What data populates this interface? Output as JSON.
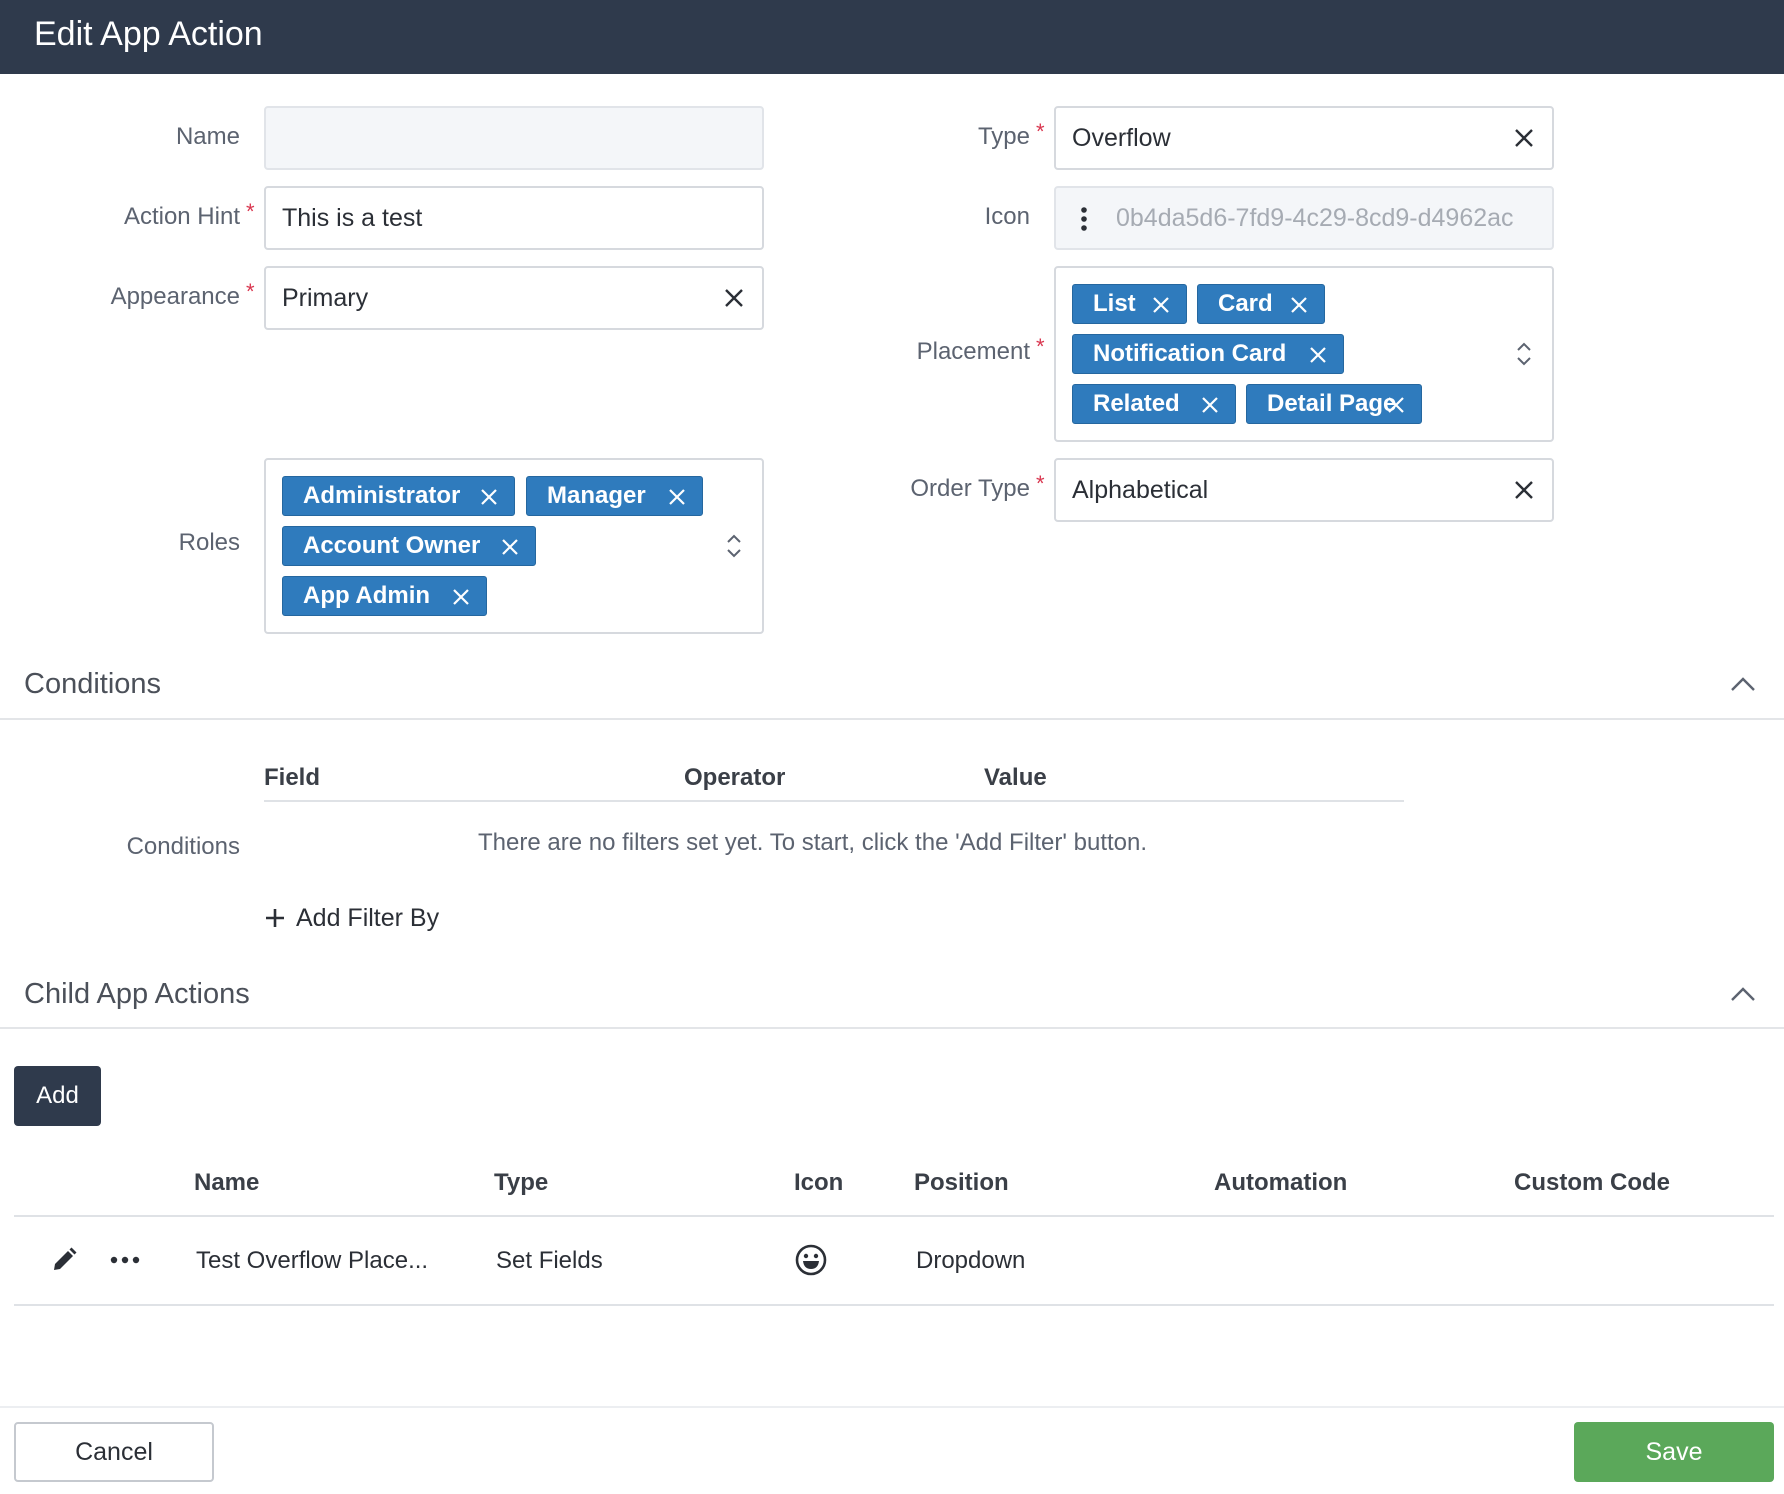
{
  "header": {
    "title": "Edit App Action"
  },
  "form": {
    "name": {
      "label": "Name",
      "value": ""
    },
    "action_hint": {
      "label": "Action Hint",
      "value": "This is a test"
    },
    "appearance": {
      "label": "Appearance",
      "value": "Primary"
    },
    "roles": {
      "label": "Roles",
      "chips": [
        "Administrator",
        "Manager",
        "Account Owner",
        "App Admin"
      ]
    },
    "type": {
      "label": "Type",
      "value": "Overflow"
    },
    "icon": {
      "label": "Icon",
      "value": "0b4da5d6-7fd9-4c29-8cd9-d4962ac"
    },
    "placement": {
      "label": "Placement",
      "chips": [
        "List",
        "Card",
        "Notification Card",
        "Related",
        "Detail Page"
      ]
    },
    "order_type": {
      "label": "Order Type",
      "value": "Alphabetical"
    },
    "required_mark": "*"
  },
  "conditions_section": {
    "title": "Conditions",
    "row_label": "Conditions",
    "columns": [
      "Field",
      "Operator",
      "Value"
    ],
    "empty_message": "There are no filters set yet. To start, click the 'Add Filter' button.",
    "add_filter_label": "Add Filter By"
  },
  "child_actions_section": {
    "title": "Child App Actions",
    "add_label": "Add",
    "columns": [
      "Name",
      "Type",
      "Icon",
      "Position",
      "Automation",
      "Custom Code"
    ],
    "rows": [
      {
        "name": "Test Overflow Place...",
        "type": "Set Fields",
        "icon": "grinning-face-icon",
        "position": "Dropdown",
        "automation": "",
        "custom_code": ""
      }
    ]
  },
  "footer": {
    "cancel_label": "Cancel",
    "save_label": "Save"
  },
  "colors": {
    "header_bg": "#2f3a4c",
    "chip_bg": "#2f7bbd",
    "required": "#d9364f",
    "save_bg": "#5ba85a",
    "add_bg": "#2f3a4c"
  }
}
